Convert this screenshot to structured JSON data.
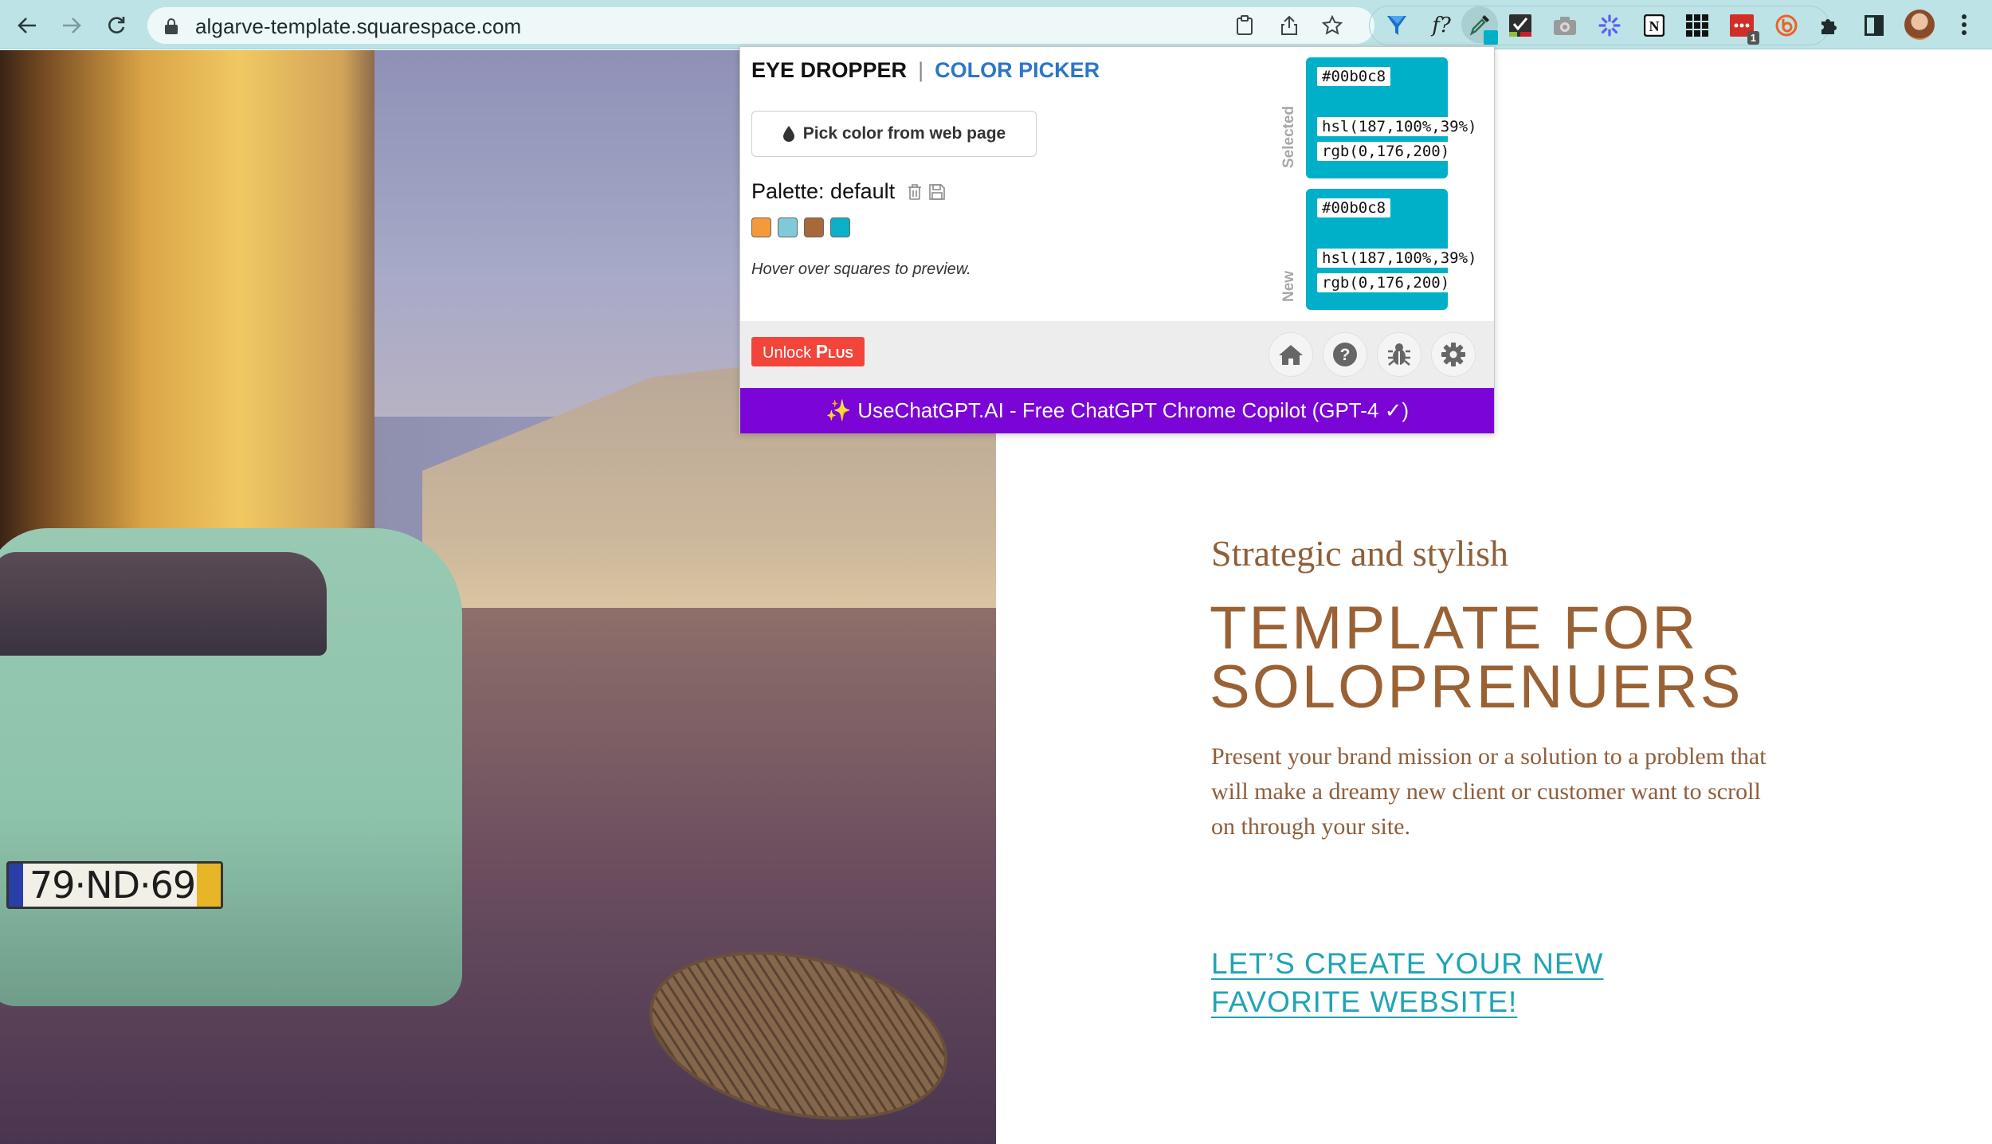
{
  "browser": {
    "url": "algarve-template.squarespace.com",
    "nav": {
      "back_icon": "arrow-left-icon",
      "forward_icon": "arrow-right-icon",
      "reload_icon": "reload-icon"
    },
    "omnibox_icons": [
      "clipboard-icon",
      "share-icon",
      "star-icon"
    ],
    "extensions": [
      {
        "name": "funnel-extension",
        "icon": "funnel-icon",
        "active": false
      },
      {
        "name": "font-finder-extension",
        "icon": "font-question-icon",
        "label": "f?",
        "active": false
      },
      {
        "name": "eye-dropper-extension",
        "icon": "eyedropper-icon",
        "active": true
      },
      {
        "name": "checkmark-extension",
        "icon": "checkmark-square-icon",
        "active": false
      },
      {
        "name": "camera-extension",
        "icon": "camera-icon",
        "active": false
      },
      {
        "name": "asterisk-extension",
        "icon": "asterisk-icon",
        "active": false
      },
      {
        "name": "notion-extension",
        "icon": "notion-icon",
        "label": "N",
        "active": false
      },
      {
        "name": "grid-extension",
        "icon": "grid-icon",
        "active": false
      },
      {
        "name": "lastpass-extension",
        "icon": "dots-icon",
        "badge": "1",
        "active": false
      },
      {
        "name": "bitly-extension",
        "icon": "bitly-icon",
        "active": false
      },
      {
        "name": "extensions-menu",
        "icon": "puzzle-icon",
        "active": false
      }
    ],
    "sidepanel_icon": "side-panel-icon",
    "avatar_icon": "profile-avatar",
    "menu_icon": "kebab-menu-icon"
  },
  "popup": {
    "tabs": {
      "eyedropper": "EYE DROPPER",
      "separator": "|",
      "colorpicker": "COLOR PICKER"
    },
    "pick_button": "Pick color from web page",
    "palette_label": "Palette: default",
    "palette_colors": [
      "#f5993b",
      "#7ecad8",
      "#a8693a",
      "#0cb0c8"
    ],
    "hint": "Hover over squares to preview.",
    "selected": {
      "label": "Selected",
      "color": "#00b0c8",
      "hex": "#00b0c8",
      "hsl": "hsl(187,100%,39%)",
      "rgb": "rgb(0,176,200)"
    },
    "new": {
      "label": "New",
      "color": "#00b0c8",
      "hex": "#00b0c8",
      "hsl": "hsl(187,100%,39%)",
      "rgb": "rgb(0,176,200)"
    },
    "unlock": {
      "prefix": "Unlock ",
      "emphasis": "Plus"
    },
    "footer_icons": [
      "home-icon",
      "help-icon",
      "bug-icon",
      "settings-icon"
    ],
    "promo": {
      "sparkle": "✨",
      "text": "UseChatGPT.AI - Free ChatGPT Chrome Copilot (GPT-4 ✓)"
    }
  },
  "page": {
    "hero_image_alt": "Green vintage car on cobblestone street at dusk",
    "license_plate": "79·ND·69",
    "tagline": "Strategic and stylish",
    "headline": "TEMPLATE FOR SOLOPRENUERS",
    "body": "Present your brand mission or a solution to a problem that will make a dreamy new client or customer want to scroll on through your site.",
    "cta": "LET’S CREATE YOUR NEW FAVORITE WEBSITE!",
    "colors": {
      "brand_brown": "#9a6234",
      "accent_teal": "#1fa4b6"
    }
  }
}
